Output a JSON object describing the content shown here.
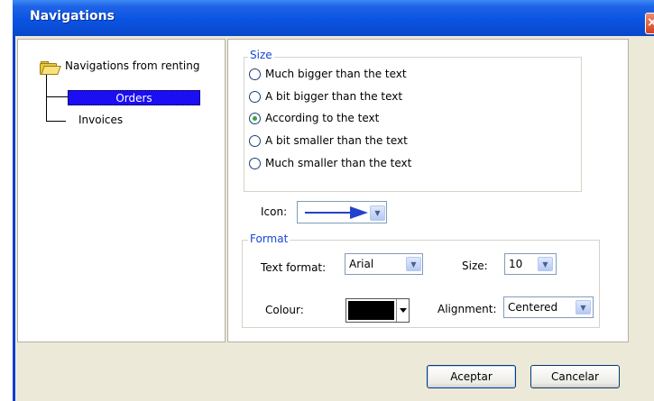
{
  "window": {
    "title": "Navigations",
    "close_glyph": "×"
  },
  "tree": {
    "root_label": "Navigations from renting",
    "items": [
      {
        "label": "Orders",
        "selected": true
      },
      {
        "label": "Invoices",
        "selected": false
      }
    ]
  },
  "size_group": {
    "legend": "Size",
    "options": [
      {
        "label": "Much bigger than the text",
        "checked": false
      },
      {
        "label": "A bit bigger than the text",
        "checked": false
      },
      {
        "label": "According to the text",
        "checked": true
      },
      {
        "label": "A bit smaller than the text",
        "checked": false
      },
      {
        "label": "Much smaller than the text",
        "checked": false
      }
    ]
  },
  "icon": {
    "label": "Icon:",
    "selected_icon": "arrow-right-icon"
  },
  "format_group": {
    "legend": "Format",
    "text_format_label": "Text format:",
    "text_format_value": "Arial",
    "size_label": "Size:",
    "size_value": "10",
    "colour_label": "Colour:",
    "colour_value": "#000000",
    "alignment_label": "Alignment:",
    "alignment_value": "Centered"
  },
  "buttons": {
    "ok": "Aceptar",
    "cancel": "Cancelar"
  },
  "colors": {
    "titlebar": "#0a54e3",
    "selection": "#1b0ef5",
    "legend": "#1546d5"
  }
}
